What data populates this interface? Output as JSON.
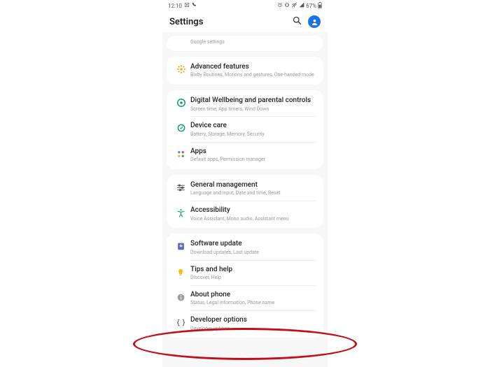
{
  "statusbar": {
    "time": "12:10",
    "battery": "67%"
  },
  "header": {
    "title": "Settings"
  },
  "partial": {
    "sub": "Google settings"
  },
  "items": {
    "advanced": {
      "title": "Advanced features",
      "sub": "Bixby Routines, Motions and gestures, One-handed mode"
    },
    "wellbeing": {
      "title": "Digital Wellbeing and parental controls",
      "sub": "Screen time, App timers, Wind Down"
    },
    "devicecare": {
      "title": "Device care",
      "sub": "Battery, Storage, Memory, Security"
    },
    "apps": {
      "title": "Apps",
      "sub": "Default apps, Permission manager"
    },
    "general": {
      "title": "General management",
      "sub": "Language and input, Date and time, Reset"
    },
    "accessibility": {
      "title": "Accessibility",
      "sub": "Voice Assistant, Mono audio, Assistant menu"
    },
    "software": {
      "title": "Software update",
      "sub": "Download updates, Last update"
    },
    "tips": {
      "title": "Tips and help",
      "sub": "Discover, Help"
    },
    "about": {
      "title": "About phone",
      "sub": "Status, Legal information, Phone name"
    },
    "developer": {
      "title": "Developer options",
      "sub": "Developer options"
    }
  }
}
